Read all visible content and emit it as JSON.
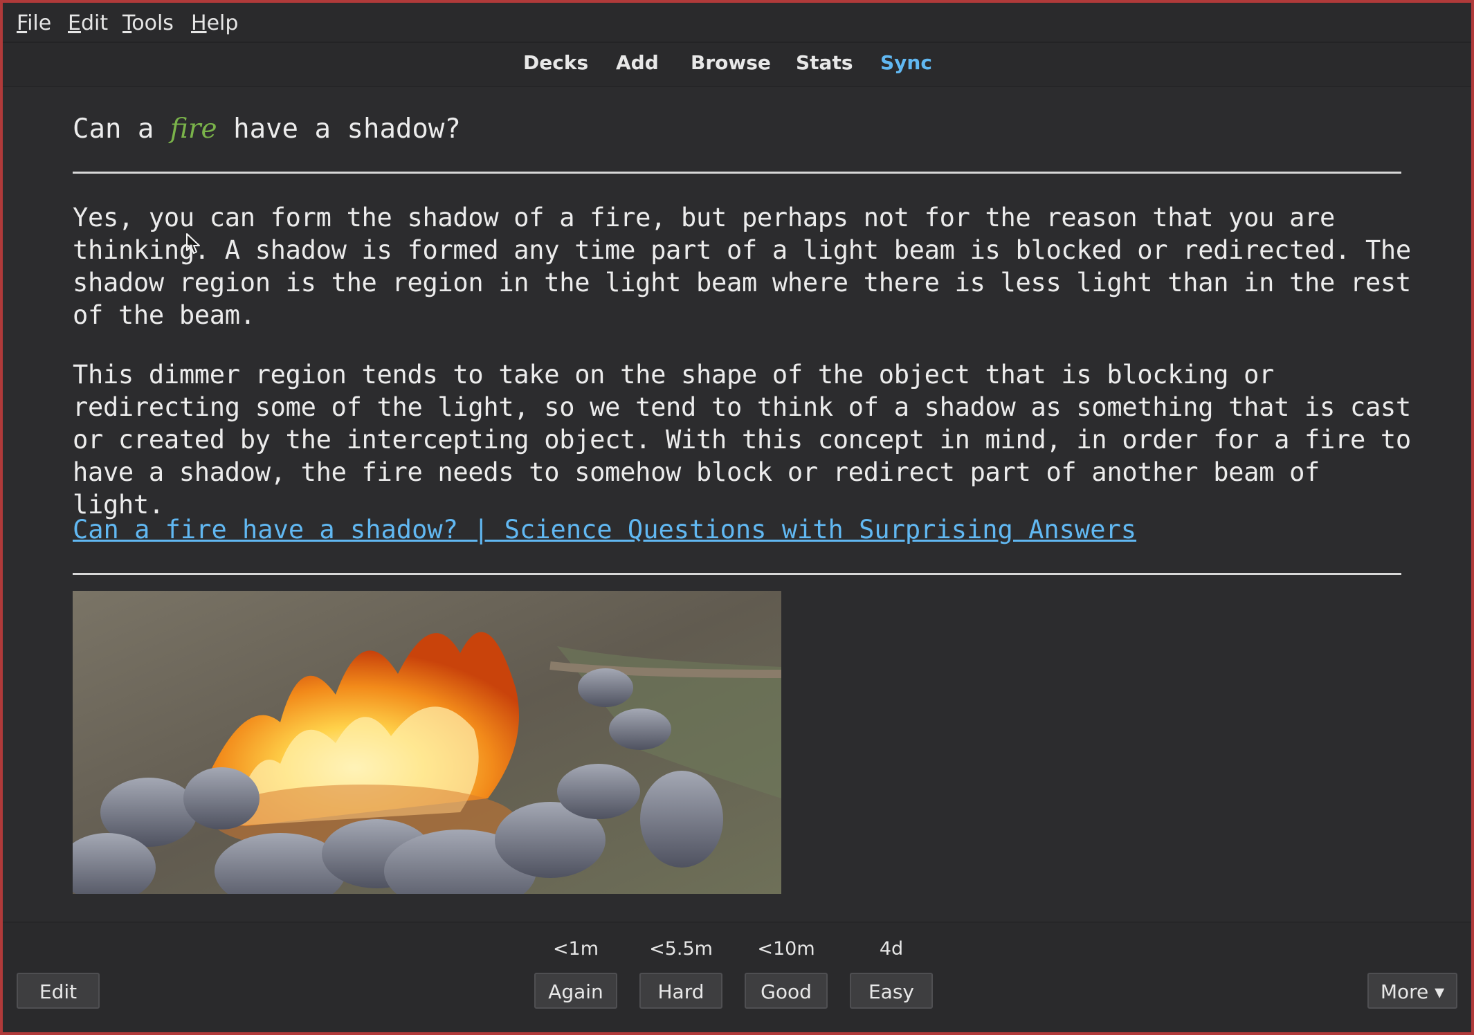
{
  "menu": {
    "file": {
      "mnemonic": "F",
      "rest": "ile"
    },
    "edit": {
      "mnemonic": "E",
      "rest": "dit"
    },
    "tools": {
      "mnemonic": "T",
      "rest": "ools"
    },
    "help": {
      "mnemonic": "H",
      "rest": "elp"
    }
  },
  "nav": {
    "decks": "Decks",
    "add": "Add",
    "browse": "Browse",
    "stats": "Stats",
    "sync": "Sync",
    "active_color": "#61b8f2"
  },
  "card": {
    "question": {
      "before": "Can a ",
      "highlight": "fire",
      "after": " have a shadow?",
      "highlight_color": "#7ab34a"
    },
    "answer_paragraph_1": "Yes, you can form the shadow of a fire, but perhaps not for the reason that you are thinking. A shadow is formed any time part of a light beam is blocked or redirected. The shadow region is the region in the light beam where there is less light than in the rest of the beam.",
    "answer_paragraph_2": "This dimmer region tends to take on the shape of the object that is blocking or redirecting some of the light, so we tend to think of a shadow as something that is cast or created by the intercepting object. With this concept in mind, in order for a fire to have a shadow, the fire needs to somehow block or redirect part of another beam of light.",
    "source_link": "Can a fire have a shadow? | Science Questions with Surprising Answers",
    "image_icon": "campfire-photo"
  },
  "review": {
    "edit_label": "Edit",
    "more_label": "More ▾",
    "answers": [
      {
        "label": "Again",
        "interval": "<1m"
      },
      {
        "label": "Hard",
        "interval": "<5.5m"
      },
      {
        "label": "Good",
        "interval": "<10m"
      },
      {
        "label": "Easy",
        "interval": "4d"
      }
    ]
  }
}
